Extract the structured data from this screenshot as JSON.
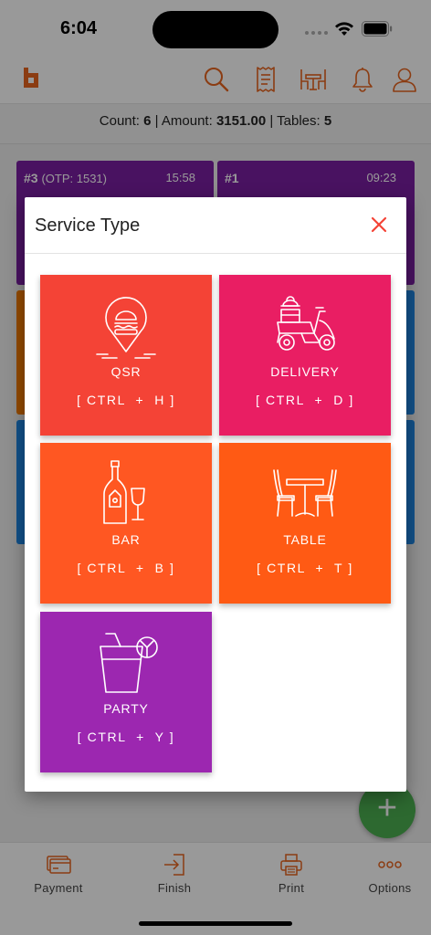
{
  "status_bar": {
    "time": "6:04"
  },
  "summary": {
    "count_label": "Count:",
    "count_value": "6",
    "amount_label": "Amount:",
    "amount_value": "3151.00",
    "tables_label": "Tables:",
    "tables_value": "5"
  },
  "orders": [
    {
      "number": "#3",
      "otp": "(OTP: 1531)",
      "time": "15:58",
      "color": "#7b1fa2"
    },
    {
      "number": "#1",
      "otp": "",
      "time": "09:23",
      "color": "#7b1fa2"
    }
  ],
  "dialog": {
    "title": "Service Type",
    "tiles": [
      {
        "label": "QSR",
        "shortcut": "[ CTRL  +  H ]",
        "color": "#f44336",
        "icon": "burger-location-icon"
      },
      {
        "label": "DELIVERY",
        "shortcut": "[ CTRL  +  D ]",
        "color": "#e91e63",
        "icon": "delivery-scooter-icon"
      },
      {
        "label": "BAR",
        "shortcut": "[ CTRL  +  B ]",
        "color": "#ff5722",
        "icon": "wine-bottle-glass-icon"
      },
      {
        "label": "TABLE",
        "shortcut": "[ CTRL  +  T ]",
        "color": "#ff5a14",
        "icon": "table-chairs-icon"
      },
      {
        "label": "PARTY",
        "shortcut": "[ CTRL  +  Y ]",
        "color": "#9c27b0",
        "icon": "cocktail-glass-icon"
      }
    ]
  },
  "bottom_nav": [
    {
      "label": "Payment",
      "icon": "card-icon"
    },
    {
      "label": "Finish",
      "icon": "exit-door-icon"
    },
    {
      "label": "Print",
      "icon": "printer-icon"
    },
    {
      "label": "Options",
      "icon": "more-dots-icon"
    }
  ],
  "colors": {
    "accent": "#e8651f",
    "fab": "#4caf50",
    "close": "#f44336"
  }
}
